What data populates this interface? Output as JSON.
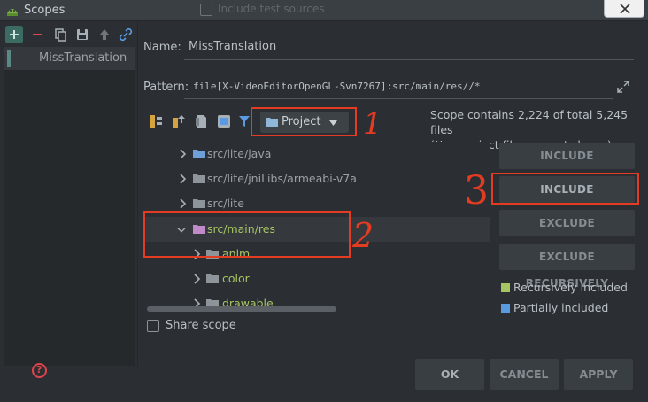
{
  "window": {
    "title": "Scopes",
    "background_text": "Include test sources"
  },
  "left_toolbar": {
    "icons": [
      "add-icon",
      "remove-icon",
      "copy-icon",
      "save-icon",
      "move-up-icon",
      "link-icon"
    ]
  },
  "scopes": [
    {
      "label": "MissTranslation"
    }
  ],
  "name": {
    "label": "Name:",
    "value": "MissTranslation"
  },
  "pattern": {
    "label": "Pattern:",
    "value": "file[X-VideoEditorOpenGL-Svn7267]:src/main/res//*"
  },
  "view_selector": {
    "value": "Project"
  },
  "scope_info": {
    "line1": "Scope contains 2,224 of total 5,245 files",
    "line2": "(Non-project files are not shown)"
  },
  "tree": [
    {
      "label": "src/lite/java",
      "expanded": false,
      "color": "#9aa1a7"
    },
    {
      "label": "src/lite/jniLibs/armeabi-v7a",
      "expanded": false,
      "color": "#9aa1a7"
    },
    {
      "label": "src/lite",
      "expanded": false,
      "color": "#9aa1a7"
    },
    {
      "label": "src/main/res",
      "expanded": true,
      "color": "#a7c463",
      "selected": true
    },
    {
      "label": "anim",
      "expanded": false,
      "color": "#a7c463"
    },
    {
      "label": "color",
      "expanded": false,
      "color": "#a7c463"
    },
    {
      "label": "drawable",
      "expanded": false,
      "color": "#a7c463"
    }
  ],
  "actions": {
    "include": "INCLUDE",
    "include_recursively": "INCLUDE RECURSIVELY",
    "exclude": "EXCLUDE",
    "exclude_recursively": "EXCLUDE RECURSIVELY"
  },
  "legend": [
    {
      "label": "Recursively included",
      "color": "#a7c463"
    },
    {
      "label": "Partially included",
      "color": "#5a9ae0"
    }
  ],
  "share_scope": {
    "label": "Share scope",
    "checked": false
  },
  "footer": {
    "ok": "OK",
    "cancel": "CANCEL",
    "apply": "APPLY"
  },
  "annotations": {
    "mark1": "1",
    "mark2": "2",
    "mark3": "3"
  },
  "colors": {
    "accent_red": "#e43c22",
    "included_green": "#a7c463",
    "partial_blue": "#5a9ae0"
  }
}
